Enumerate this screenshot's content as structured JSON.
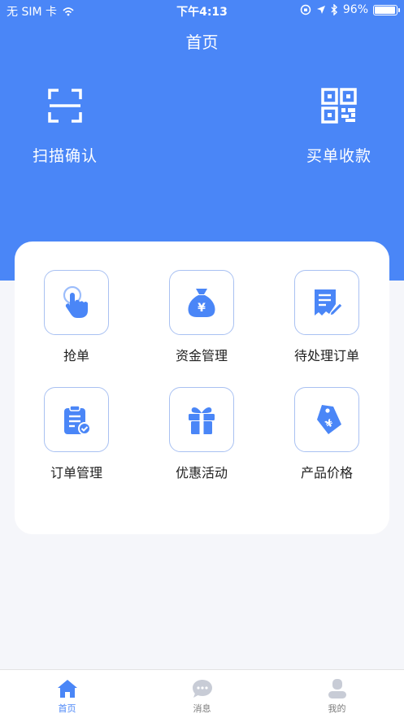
{
  "status_bar": {
    "carrier": "无 SIM 卡",
    "time": "下午4:13",
    "battery": "96%",
    "battery_level": 0.96
  },
  "header": {
    "title": "首页"
  },
  "quick_actions": [
    {
      "label": "扫描确认",
      "icon": "scan-icon"
    },
    {
      "label": "买单收款",
      "icon": "qr-code-icon"
    }
  ],
  "grid": [
    {
      "label": "抢单",
      "icon": "tap-hand-icon"
    },
    {
      "label": "资金管理",
      "icon": "money-bag-icon"
    },
    {
      "label": "待处理订单",
      "icon": "edit-document-icon"
    },
    {
      "label": "订单管理",
      "icon": "clipboard-check-icon"
    },
    {
      "label": "优惠活动",
      "icon": "gift-icon"
    },
    {
      "label": "产品价格",
      "icon": "price-tag-icon"
    }
  ],
  "tabs": [
    {
      "label": "首页",
      "icon": "home-icon",
      "active": true
    },
    {
      "label": "消息",
      "icon": "chat-icon",
      "active": false
    },
    {
      "label": "我的",
      "icon": "user-icon",
      "active": false
    }
  ],
  "colors": {
    "primary": "#4a86f7",
    "background": "#f5f6fa",
    "tile_border": "#a9c1f2",
    "tab_inactive": "#c8ccd6"
  }
}
